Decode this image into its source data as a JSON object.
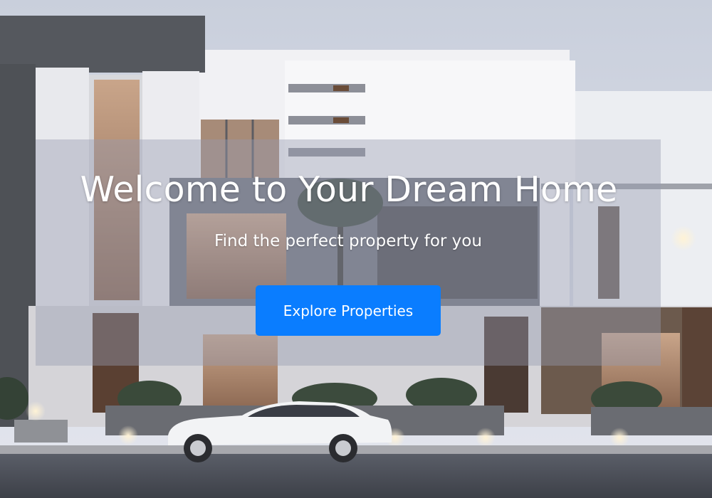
{
  "hero": {
    "title": "Welcome to Your Dream Home",
    "subtitle": "Find the perfect property for you",
    "cta_label": "Explore Properties",
    "cta_color": "#0a7dff",
    "background": "modern-house-photo"
  }
}
